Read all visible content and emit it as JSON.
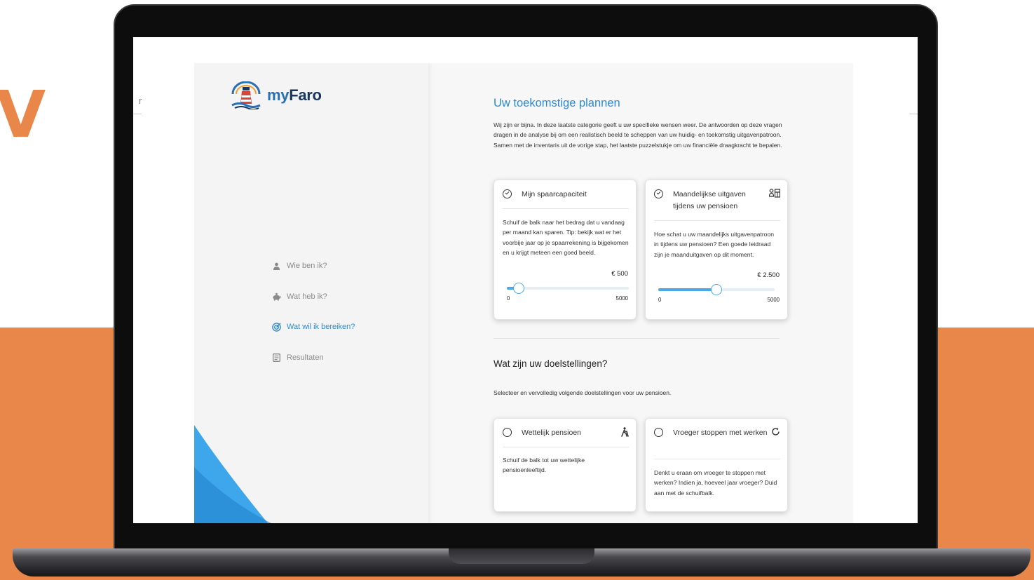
{
  "background": {
    "letter": "V",
    "accent_color": "#e9874a"
  },
  "left_edge_text": "r",
  "app": {
    "brand": {
      "logo_text_prefix": "my",
      "logo_text_main": "Faro",
      "logo_icon": "lighthouse-icon"
    },
    "sidebar": {
      "items": [
        {
          "label": "Wie ben ik?",
          "icon": "person-icon",
          "active": false
        },
        {
          "label": "Wat heb ik?",
          "icon": "piggy-bank-icon",
          "active": false
        },
        {
          "label": "Wat wil ik bereiken?",
          "icon": "target-icon",
          "active": true
        },
        {
          "label": "Resultaten",
          "icon": "document-icon",
          "active": false
        }
      ]
    },
    "main": {
      "title": "Uw toekomstige plannen",
      "intro": "Wij zijn er bijna. In deze laatste categorie geeft u uw specifieke wensen weer. De antwoorden op deze vragen dragen in de analyse bij om een realistisch beeld te scheppen van uw huidig- en toekomstig uitgavenpatroon. Samen met de inventaris uit de vorige stap, het laatste puzzelstukje om uw financiële draagkracht te bepalen.",
      "cards_top": [
        {
          "title": "Mijn spaarcapaciteit",
          "checked": true,
          "icon": "",
          "body": "Schuif de balk naar het bedrag dat u vandaag per maand kan sparen. Tip: bekijk wat er het voorbije jaar op je spaarrekening is bijgekomen en u krijgt meteen een goed beeld.",
          "value_label": "€ 500",
          "value": 500,
          "min": "0",
          "max": "5000"
        },
        {
          "title": "Maandelijkse uitgaven tijdens uw pensioen",
          "checked": true,
          "icon": "people-calendar-icon",
          "body": "Hoe schat u uw maandelijks uitgavenpatroon in tijdens uw pensioen? Een goede leidraad zijn je maanduitgaven op dit moment.",
          "value_label": "€ 2.500",
          "value": 2500,
          "min": "0",
          "max": "5000"
        }
      ],
      "goals": {
        "title": "Wat zijn uw doelstellingen?",
        "subtitle": "Selecteer en vervolledig volgende doelstellingen voor uw pensioen.",
        "cards": [
          {
            "title": "Wettelijk pensioen",
            "checked": false,
            "icon": "walking-person-icon",
            "body": "Schuif de balk tot uw wettelijke pensioenleeftijd."
          },
          {
            "title": "Vroeger stoppen met werken",
            "checked": false,
            "icon": "refresh-icon",
            "body": "Denkt u eraan om vroeger te stoppen met werken? Indien ja, hoeveel jaar vroeger? Duid aan met de schuifbalk."
          }
        ]
      }
    }
  }
}
